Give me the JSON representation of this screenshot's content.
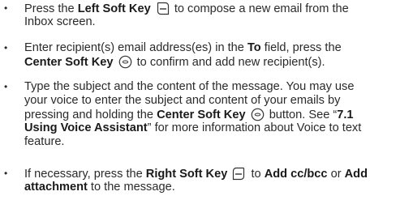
{
  "bullet": "•",
  "items": [
    {
      "l1a": "Press the ",
      "l1b": "Left Soft Key",
      "l1c": " to compose a new email from the",
      "l2": "Inbox screen."
    },
    {
      "l1a": "Enter recipient(s) email address(es) in the ",
      "l1b": "To",
      "l1c": " field, press the",
      "l2a": "Center Soft Key",
      "l2b": " to confirm and add new recipient(s)."
    },
    {
      "l1": "Type the subject and the content of the message. You may use",
      "l2": "your voice to enter the subject and content of your emails by",
      "l3a": "pressing and holding the ",
      "l3b": "Center Soft Key",
      "l3c": " button. See “",
      "l3d": "7.1",
      "l4a": "Using Voice Assistant",
      "l4b": "” for more information about Voice to text",
      "l5": "feature."
    },
    {
      "l1a": "If necessary, press the ",
      "l1b": "Right Soft Key",
      "l1c": " to ",
      "l1d": "Add cc/bcc",
      "l1e": " or ",
      "l1f": "Add",
      "l2a": "attachment",
      "l2b": " to the message."
    }
  ],
  "icons": {
    "left_soft_key": "left-soft-key-icon",
    "center_soft_key": "center-soft-key-icon",
    "right_soft_key": "right-soft-key-icon"
  }
}
